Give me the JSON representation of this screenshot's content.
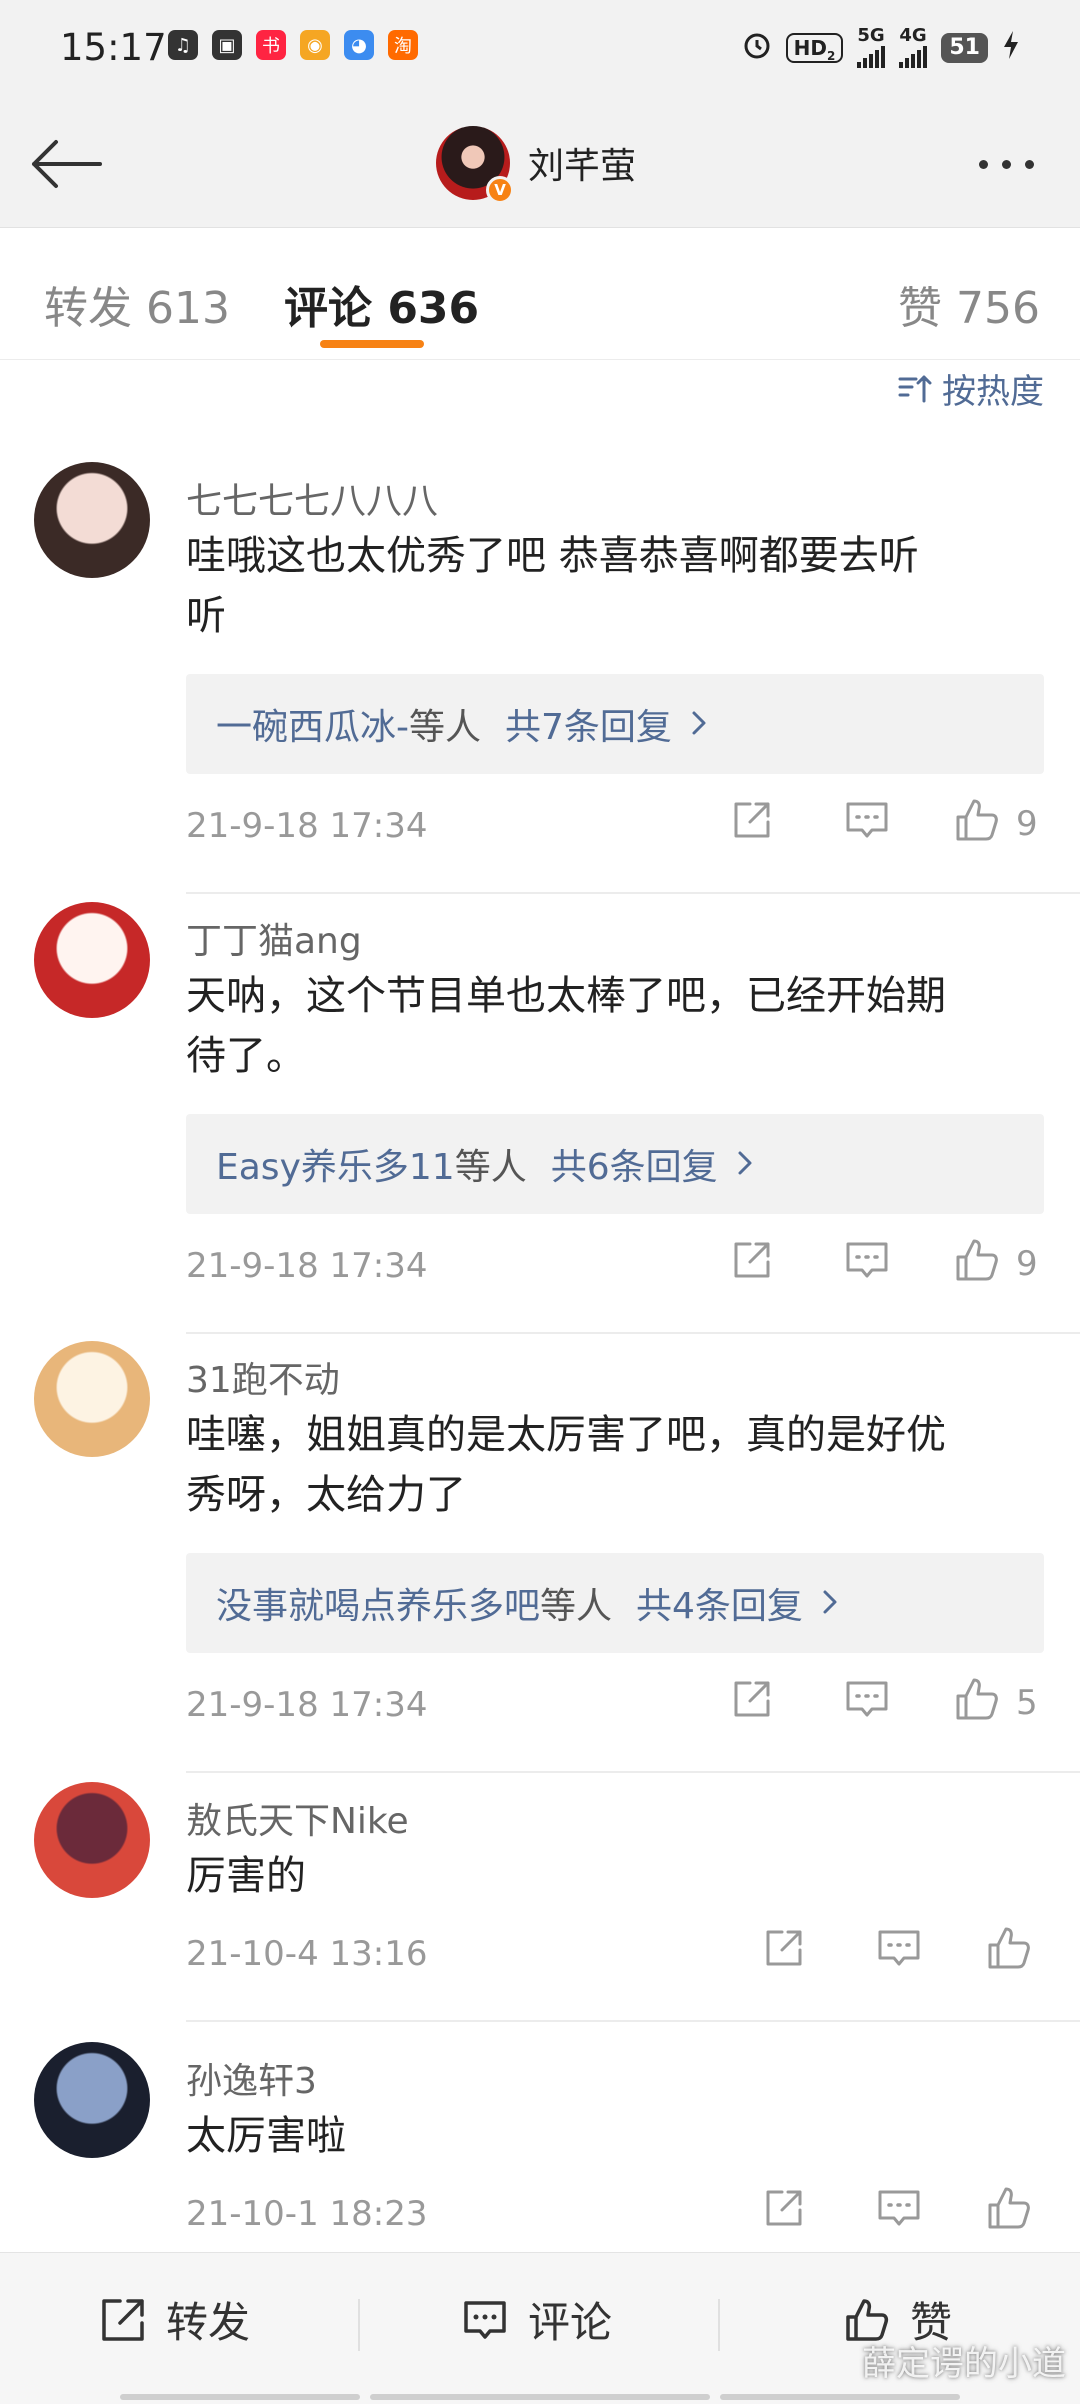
{
  "status_bar": {
    "time": "15:17",
    "hd": "HD",
    "sub2": "2",
    "net1": "5G",
    "net2": "4G",
    "battery": "51",
    "app_icons": [
      {
        "name": "music-icon",
        "color": "#333333",
        "glyph": "♫"
      },
      {
        "name": "bilibili-icon",
        "color": "#333333",
        "glyph": "▣"
      },
      {
        "name": "xiaohongshu-icon",
        "color": "#ff2442",
        "glyph": "书"
      },
      {
        "name": "weibo-icon",
        "color": "#f5a623",
        "glyph": "◉"
      },
      {
        "name": "qq-icon",
        "color": "#3c8cf0",
        "glyph": "◕"
      },
      {
        "name": "taobao-icon",
        "color": "#ff6a00",
        "glyph": "淘"
      }
    ]
  },
  "header": {
    "title": "刘芊萤",
    "verified_badge": "V"
  },
  "tabs": [
    {
      "label": "转发 613",
      "active": false
    },
    {
      "label": "评论 636",
      "active": true
    },
    {
      "label": "赞 756",
      "active": false
    }
  ],
  "sort": {
    "label": "按热度"
  },
  "comments": [
    {
      "username": "七七七七八八八",
      "text_lines": [
        "哇哦这也太优秀了吧 恭喜恭喜啊都要去听",
        "听"
      ],
      "replies": {
        "name": "一碗西瓜冰-",
        "etc": "等人",
        "total": "共7条回复"
      },
      "time": "21-9-18 17:34",
      "likes": "9",
      "avatar_colors": [
        "#f3dcd5",
        "#3b2a26"
      ]
    },
    {
      "username": "丁丁猫ang",
      "text_lines": [
        "天呐，这个节目单也太棒了吧，已经开始期",
        "待了。"
      ],
      "replies": {
        "name": "Easy养乐多11",
        "etc": "等人",
        "total": "共6条回复"
      },
      "time": "21-9-18 17:34",
      "likes": "9",
      "avatar_colors": [
        "#fff4f0",
        "#c62828"
      ]
    },
    {
      "username": "31跑不动",
      "text_lines": [
        "哇噻，姐姐真的是太厉害了吧，真的是好优",
        "秀呀，太给力了"
      ],
      "replies": {
        "name": "没事就喝点养乐多吧",
        "etc": "等人",
        "total": "共4条回复"
      },
      "time": "21-9-18 17:34",
      "likes": "5",
      "avatar_colors": [
        "#fdf3e3",
        "#e8b67a"
      ]
    },
    {
      "username": "敖氏天下Nike",
      "text_lines": [
        "厉害的"
      ],
      "replies": null,
      "time": "21-10-4 13:16",
      "likes": "",
      "avatar_colors": [
        "#6b2a3a",
        "#d9483b"
      ]
    },
    {
      "username": "孙逸轩3",
      "text_lines": [
        "太厉害啦"
      ],
      "replies": null,
      "time": "21-10-1 18:23",
      "likes": "",
      "avatar_colors": [
        "#8aa0c8",
        "#1a1f2e"
      ]
    }
  ],
  "bottom_bar": {
    "repost": "转发",
    "comment": "评论",
    "like": "赞"
  },
  "watermark": "薛定谔的小道"
}
